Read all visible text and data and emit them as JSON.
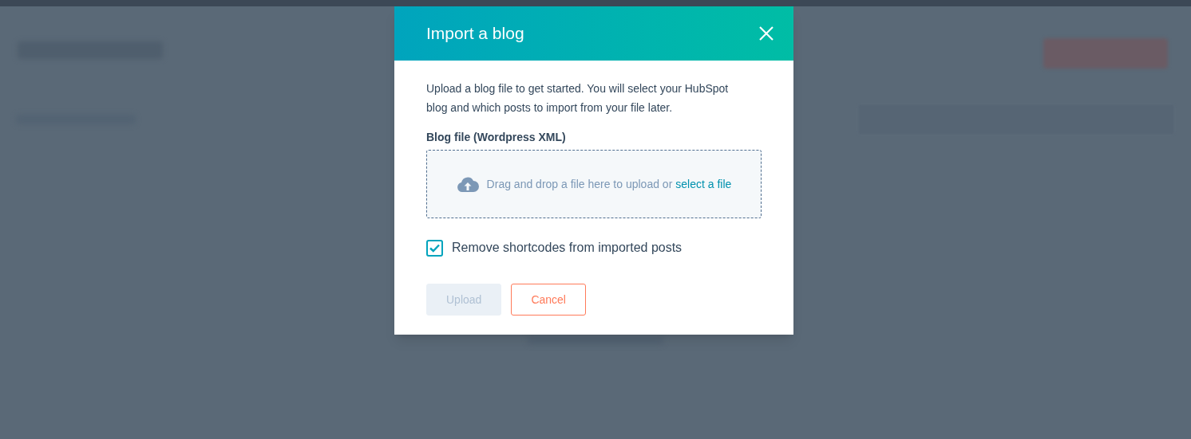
{
  "dialog": {
    "title": "Import a blog",
    "intro": "Upload a blog file to get started. You will select your HubSpot blog and which posts to import from your file later.",
    "file_field": {
      "label": "Blog file (Wordpress XML)",
      "hint": "Drag and drop a file here to upload or",
      "link": "select a file"
    },
    "option": {
      "label": "Remove shortcodes from imported posts",
      "checked": true
    },
    "buttons": [
      {
        "label": "Upload",
        "kind": "primary",
        "disabled": true
      },
      {
        "label": "Cancel",
        "kind": "secondary",
        "disabled": false
      }
    ]
  }
}
